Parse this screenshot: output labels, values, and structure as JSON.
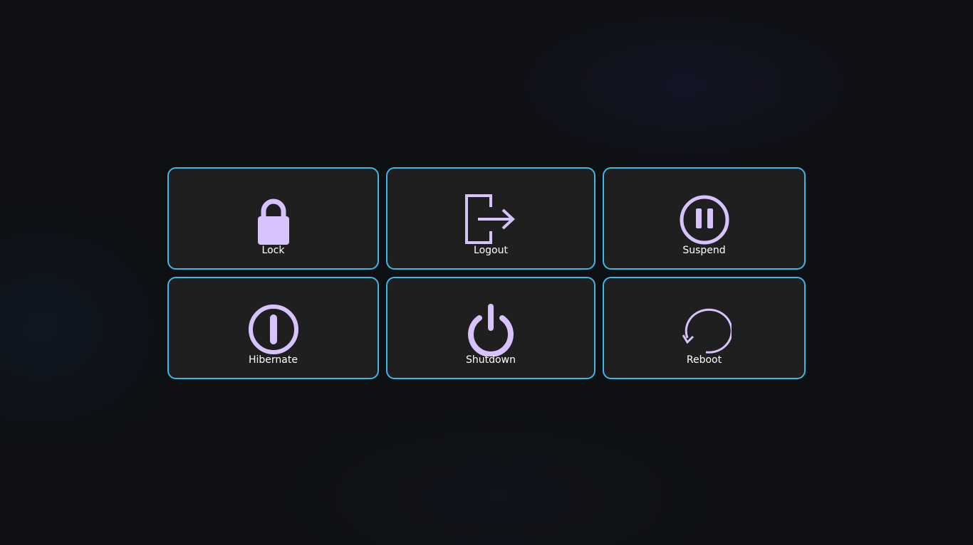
{
  "accent_border": "#3fb7e9",
  "icon_color": "#d7c2fb",
  "tile_background": "#1f1f1f",
  "buttons": [
    {
      "label": "Lock",
      "icon": "lock-icon"
    },
    {
      "label": "Logout",
      "icon": "logout-icon"
    },
    {
      "label": "Suspend",
      "icon": "pause-icon"
    },
    {
      "label": "Hibernate",
      "icon": "hibernate-icon"
    },
    {
      "label": "Shutdown",
      "icon": "power-icon"
    },
    {
      "label": "Reboot",
      "icon": "reboot-icon"
    }
  ]
}
